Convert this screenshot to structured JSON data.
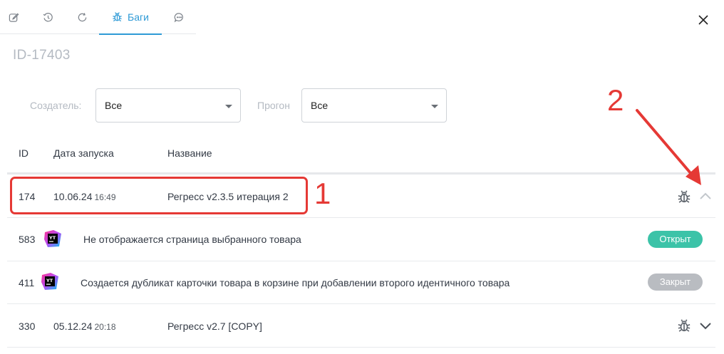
{
  "tabs": [
    {
      "icon": "edit-icon",
      "label": ""
    },
    {
      "icon": "history-icon",
      "label": ""
    },
    {
      "icon": "refresh-icon",
      "label": ""
    },
    {
      "icon": "bug-icon",
      "label": "Баги"
    },
    {
      "icon": "comment-icon",
      "label": ""
    }
  ],
  "record_id": "ID-17403",
  "filters": {
    "creator_label": "Создатель:",
    "creator_value": "Все",
    "run_label": "Прогон",
    "run_value": "Все"
  },
  "columns": {
    "id": "ID",
    "date": "Дата запуска",
    "name": "Название"
  },
  "runs": [
    {
      "id": "174",
      "date": "10.06.24",
      "time": "16:49",
      "name": "Регресс v2.3.5 итерация 2",
      "expanded": true,
      "bugs": [
        {
          "id": "583",
          "title": "Не отображается страница выбранного товара",
          "status": "Открыт",
          "status_color": "#3cc3a8"
        },
        {
          "id": "411",
          "title": "Создается дубликат карточки товара в корзине при добавлении второго идентичного товара",
          "status": "Закрыт",
          "status_color": "#b9bcc1"
        }
      ]
    },
    {
      "id": "330",
      "date": "05.12.24",
      "time": "20:18",
      "name": "Регресс v2.7 [COPY]",
      "expanded": false,
      "bugs": []
    }
  ],
  "yt_logo_text": "YT",
  "annotations": {
    "label_1": "1",
    "label_2": "2",
    "color": "#e53935"
  },
  "colors": {
    "accent": "#2e9ad6",
    "muted": "#b4bac2",
    "open": "#3cc3a8",
    "closed": "#b9bcc1"
  }
}
